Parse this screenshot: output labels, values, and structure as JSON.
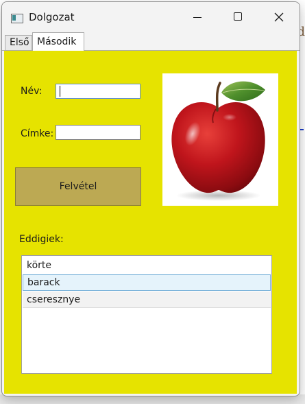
{
  "window": {
    "title": "Dolgozat"
  },
  "tabs": [
    {
      "label": "Első",
      "selected": false
    },
    {
      "label": "Második",
      "selected": true
    }
  ],
  "form": {
    "name_label": "Név:",
    "name_value": "",
    "tag_label": "Címke:",
    "tag_value": "",
    "submit_label": "Felvétel",
    "image": "apple-image"
  },
  "list": {
    "label": "Eddigiek:",
    "items": [
      {
        "text": "körte",
        "state": "normal"
      },
      {
        "text": "barack",
        "state": "selected"
      },
      {
        "text": "cseresznye",
        "state": "hover"
      }
    ]
  },
  "colors": {
    "panel_background": "#e6e300",
    "button_background": "#bca953",
    "selected_item": "#e5f3fb",
    "selected_border": "#7bb3da"
  },
  "background_peek": {
    "letter": "d",
    "close_glyph": "×"
  }
}
